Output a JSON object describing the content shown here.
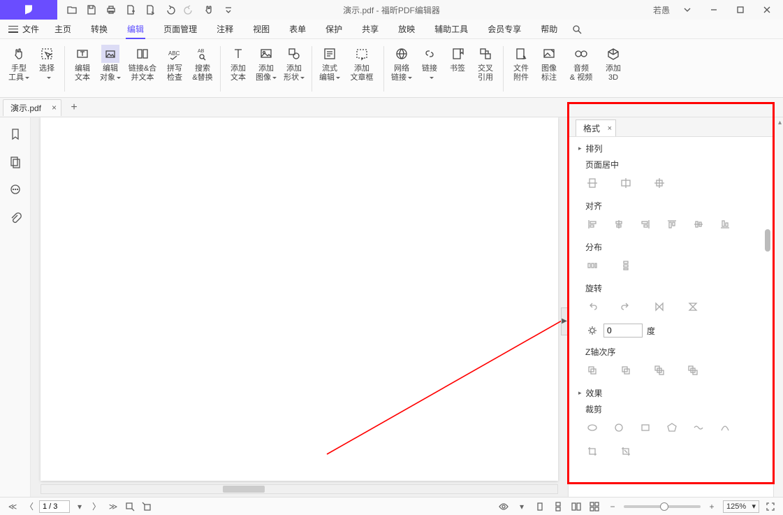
{
  "title": {
    "doc": "演示.pdf",
    "sep": " - ",
    "app": "福昕PDF编辑器"
  },
  "user": "若愚",
  "menu": {
    "file": "文件",
    "items": [
      "主页",
      "转换",
      "编辑",
      "页面管理",
      "注释",
      "视图",
      "表单",
      "保护",
      "共享",
      "放映",
      "辅助工具",
      "会员专享",
      "帮助"
    ],
    "active_index": 2
  },
  "ribbon": {
    "hand": {
      "l1": "手型",
      "l2": "工具"
    },
    "select": {
      "l1": "选择"
    },
    "edit_text": {
      "l1": "编辑",
      "l2": "文本"
    },
    "edit_obj": {
      "l1": "编辑",
      "l2": "对象"
    },
    "link_merge": {
      "l1": "链接&合",
      "l2": "并文本"
    },
    "spell": {
      "l1": "拼写",
      "l2": "检查"
    },
    "search_replace": {
      "l1": "搜索",
      "l2": "&替换"
    },
    "add_text": {
      "l1": "添加",
      "l2": "文本"
    },
    "add_image": {
      "l1": "添加",
      "l2": "图像"
    },
    "add_shape": {
      "l1": "添加",
      "l2": "形状"
    },
    "flow_edit": {
      "l1": "流式",
      "l2": "编辑"
    },
    "add_article": {
      "l1": "添加",
      "l2": "文章框"
    },
    "web_link": {
      "l1": "网络",
      "l2": "链接"
    },
    "link": {
      "l1": "链接"
    },
    "bookmark": {
      "l1": "书签"
    },
    "cross_ref": {
      "l1": "交叉",
      "l2": "引用"
    },
    "file_attach": {
      "l1": "文件",
      "l2": "附件"
    },
    "image_annot": {
      "l1": "图像",
      "l2": "标注"
    },
    "audio_video": {
      "l1": "音频",
      "l2": "& 视频"
    },
    "add_3d": {
      "l1": "添加",
      "l2": "3D"
    }
  },
  "doctab": "演示.pdf",
  "panel": {
    "tab": "格式",
    "arrange": "排列",
    "page_center": "页面居中",
    "align": "对齐",
    "distribute": "分布",
    "rotate": "旋转",
    "angle_value": "0",
    "angle_unit": "度",
    "zorder": "Z轴次序",
    "effect": "效果",
    "crop": "裁剪"
  },
  "status": {
    "page": "1 / 3",
    "zoom": "125%"
  }
}
